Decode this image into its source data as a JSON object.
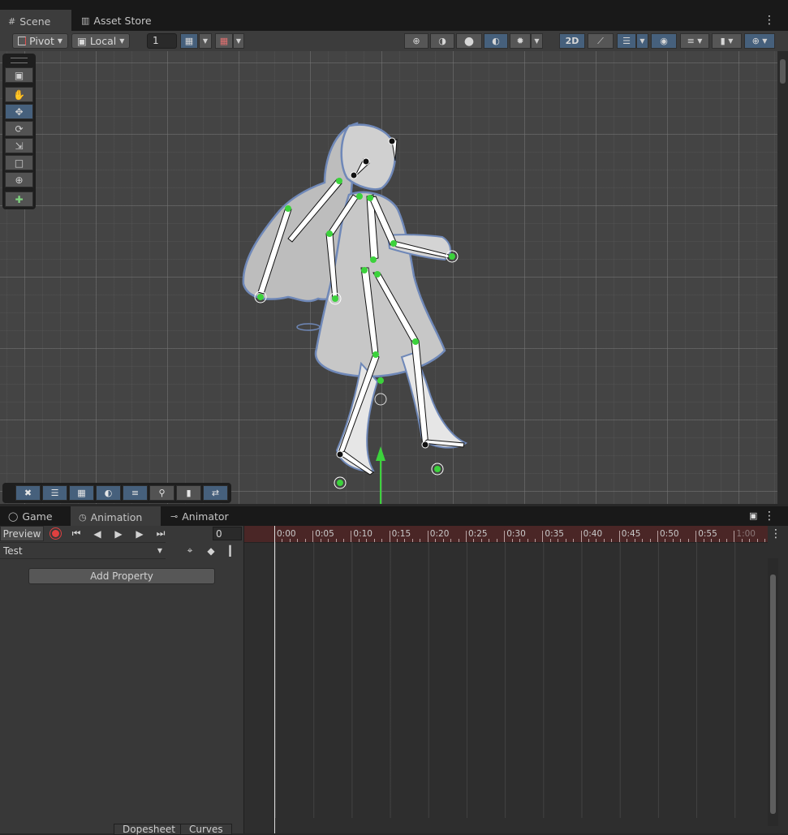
{
  "scene_tabs": [
    {
      "label": "Scene",
      "icon": "grid-icon"
    },
    {
      "label": "Asset Store",
      "icon": "bag-icon"
    }
  ],
  "scene_toolbar": {
    "pivot_label": "Pivot",
    "local_label": "Local",
    "grid_size_value": "1",
    "mode_2d_label": "2D"
  },
  "animation_tabs": [
    {
      "label": "Game",
      "icon": "gamepad-icon"
    },
    {
      "label": "Animation",
      "icon": "clock-icon"
    },
    {
      "label": "Animator",
      "icon": "animator-icon"
    }
  ],
  "animation": {
    "preview_label": "Preview",
    "frame_value": "0",
    "clip_name": "Test",
    "add_property_label": "Add Property",
    "timeline_ticks": [
      "0:00",
      "0:05",
      "0:10",
      "0:15",
      "0:20",
      "0:25",
      "0:30",
      "0:35",
      "0:40",
      "0:45",
      "0:50",
      "0:55",
      "1:00"
    ],
    "bottom_tabs": [
      "Dopesheet",
      "Curves"
    ]
  },
  "colors": {
    "accent": "#46607c",
    "bone": "#ffffff",
    "joint": "#3cd23c",
    "ruler": "#4a2626"
  }
}
